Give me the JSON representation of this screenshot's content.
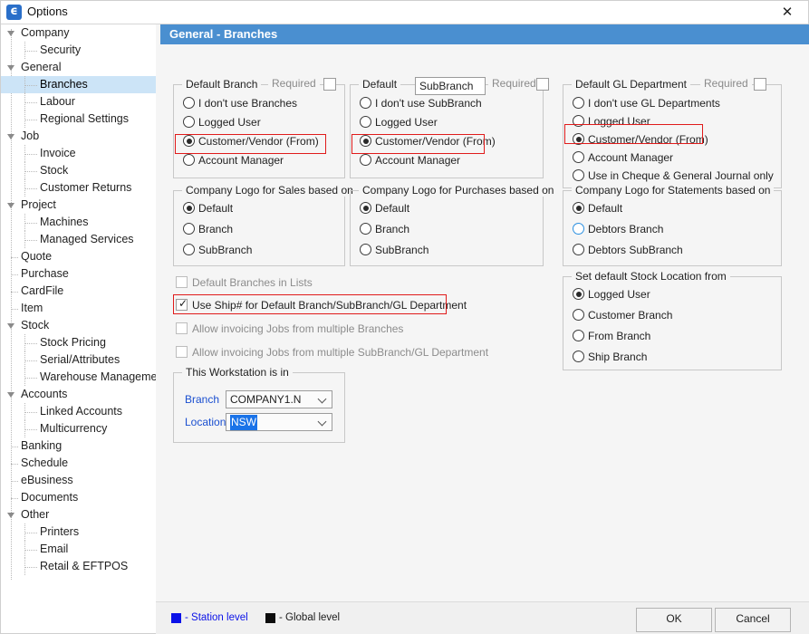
{
  "window": {
    "title": "Options",
    "app_icon": "options-app-icon",
    "close_icon": "✕"
  },
  "sidebar": {
    "items": [
      {
        "label": "Company",
        "level": 0,
        "expander": "open",
        "selected": false
      },
      {
        "label": "Security",
        "level": 1,
        "expander": "none",
        "selected": false
      },
      {
        "label": "General",
        "level": 0,
        "expander": "open",
        "selected": false
      },
      {
        "label": "Branches",
        "level": 1,
        "expander": "none",
        "selected": true
      },
      {
        "label": "Labour",
        "level": 1,
        "expander": "none",
        "selected": false
      },
      {
        "label": "Regional Settings",
        "level": 1,
        "expander": "none",
        "selected": false
      },
      {
        "label": "Job",
        "level": 0,
        "expander": "open",
        "selected": false
      },
      {
        "label": "Invoice",
        "level": 1,
        "expander": "none",
        "selected": false
      },
      {
        "label": "Stock",
        "level": 1,
        "expander": "none",
        "selected": false
      },
      {
        "label": "Customer Returns",
        "level": 1,
        "expander": "none",
        "selected": false
      },
      {
        "label": "Project",
        "level": 0,
        "expander": "open",
        "selected": false
      },
      {
        "label": "Machines",
        "level": 1,
        "expander": "none",
        "selected": false
      },
      {
        "label": "Managed Services",
        "level": 1,
        "expander": "none",
        "selected": false
      },
      {
        "label": "Quote",
        "level": 0,
        "expander": "none",
        "selected": false
      },
      {
        "label": "Purchase",
        "level": 0,
        "expander": "none",
        "selected": false
      },
      {
        "label": "CardFile",
        "level": 0,
        "expander": "none",
        "selected": false
      },
      {
        "label": "Item",
        "level": 0,
        "expander": "none",
        "selected": false
      },
      {
        "label": "Stock",
        "level": 0,
        "expander": "open",
        "selected": false
      },
      {
        "label": "Stock Pricing",
        "level": 1,
        "expander": "none",
        "selected": false
      },
      {
        "label": "Serial/Attributes",
        "level": 1,
        "expander": "none",
        "selected": false
      },
      {
        "label": "Warehouse Management",
        "level": 1,
        "expander": "none",
        "selected": false
      },
      {
        "label": "Accounts",
        "level": 0,
        "expander": "open",
        "selected": false
      },
      {
        "label": "Linked Accounts",
        "level": 1,
        "expander": "none",
        "selected": false
      },
      {
        "label": "Multicurrency",
        "level": 1,
        "expander": "none",
        "selected": false
      },
      {
        "label": "Banking",
        "level": 0,
        "expander": "none",
        "selected": false
      },
      {
        "label": "Schedule",
        "level": 0,
        "expander": "none",
        "selected": false
      },
      {
        "label": "eBusiness",
        "level": 0,
        "expander": "none",
        "selected": false
      },
      {
        "label": "Documents",
        "level": 0,
        "expander": "none",
        "selected": false
      },
      {
        "label": "Other",
        "level": 0,
        "expander": "open",
        "selected": false
      },
      {
        "label": "Printers",
        "level": 1,
        "expander": "none",
        "selected": false
      },
      {
        "label": "Email",
        "level": 1,
        "expander": "none",
        "selected": false
      },
      {
        "label": "Retail & EFTPOS",
        "level": 1,
        "expander": "none",
        "selected": false
      }
    ]
  },
  "panel": {
    "header": "General - Branches"
  },
  "groups": {
    "default_branch": {
      "title": "Default Branch",
      "required_label": "Required",
      "required_checked": false,
      "options": [
        {
          "label": "I don't use Branches",
          "selected": false
        },
        {
          "label": "Logged User",
          "selected": false
        },
        {
          "label": "Customer/Vendor (From)",
          "selected": true,
          "highlight": true
        },
        {
          "label": "Account Manager",
          "selected": false
        }
      ]
    },
    "default_subbranch": {
      "title": "Default",
      "title_field_value": "SubBranch",
      "required_label": "Required",
      "required_checked": false,
      "options": [
        {
          "label": "I don't use SubBranch",
          "selected": false
        },
        {
          "label": "Logged User",
          "selected": false
        },
        {
          "label": "Customer/Vendor (From)",
          "selected": true,
          "highlight": true
        },
        {
          "label": "Account Manager",
          "selected": false
        }
      ]
    },
    "default_gl_department": {
      "title": "Default GL Department",
      "required_label": "Required",
      "required_checked": false,
      "options": [
        {
          "label": "I don't use GL Departments",
          "selected": false
        },
        {
          "label": "Logged User",
          "selected": false
        },
        {
          "label": "Customer/Vendor (From)",
          "selected": true,
          "highlight": true
        },
        {
          "label": "Account Manager",
          "selected": false
        },
        {
          "label": "Use in Cheque & General Journal only",
          "selected": false
        }
      ]
    },
    "logo_sales": {
      "title": "Company Logo for Sales based on",
      "options": [
        {
          "label": "Default",
          "selected": true
        },
        {
          "label": "Branch",
          "selected": false
        },
        {
          "label": "SubBranch",
          "selected": false
        }
      ]
    },
    "logo_purchases": {
      "title": "Company Logo for Purchases based on",
      "options": [
        {
          "label": "Default",
          "selected": true
        },
        {
          "label": "Branch",
          "selected": false
        },
        {
          "label": "SubBranch",
          "selected": false
        }
      ]
    },
    "logo_statements": {
      "title": "Company Logo for Statements based on",
      "options": [
        {
          "label": "Default",
          "selected": true
        },
        {
          "label": "Debtors Branch",
          "selected": false,
          "hover": true
        },
        {
          "label": "Debtors SubBranch",
          "selected": false
        }
      ]
    },
    "stock_location": {
      "title": "Set default Stock Location from",
      "options": [
        {
          "label": "Logged User",
          "selected": true
        },
        {
          "label": "Customer Branch",
          "selected": false
        },
        {
          "label": "From Branch",
          "selected": false
        },
        {
          "label": "Ship Branch",
          "selected": false
        }
      ]
    },
    "workstation": {
      "title": "This Workstation is in",
      "fields": [
        {
          "label": "Branch",
          "value": "COMPANY1.N",
          "selected_text": false
        },
        {
          "label": "Location",
          "value": "NSW",
          "selected_text": true
        }
      ]
    }
  },
  "checkboxes": [
    {
      "label": "Default Branches in Lists",
      "checked": false,
      "dim": true,
      "highlight": false
    },
    {
      "label": "Use Ship# for Default Branch/SubBranch/GL Department",
      "checked": true,
      "dim": false,
      "highlight": true
    },
    {
      "label": "Allow invoicing Jobs from multiple Branches",
      "checked": false,
      "dim": true,
      "highlight": false
    },
    {
      "label": "Allow invoicing Jobs from multiple SubBranch/GL Department",
      "checked": false,
      "dim": true,
      "highlight": false
    }
  ],
  "footer": {
    "legend": [
      {
        "text": "- Station level",
        "color": "#0b12e8",
        "text_color": "#0b12e8"
      },
      {
        "text": "- Global level",
        "color": "#0d0d0d",
        "text_color": "#1a1a1a"
      }
    ],
    "buttons": [
      {
        "label": "OK"
      },
      {
        "label": "Cancel"
      }
    ]
  },
  "colors": {
    "header_blue": "#4a8fd0",
    "selection_blue": "#cce4f7",
    "highlight_red": "#e01b1b",
    "station_blue": "#1a4fd0"
  }
}
